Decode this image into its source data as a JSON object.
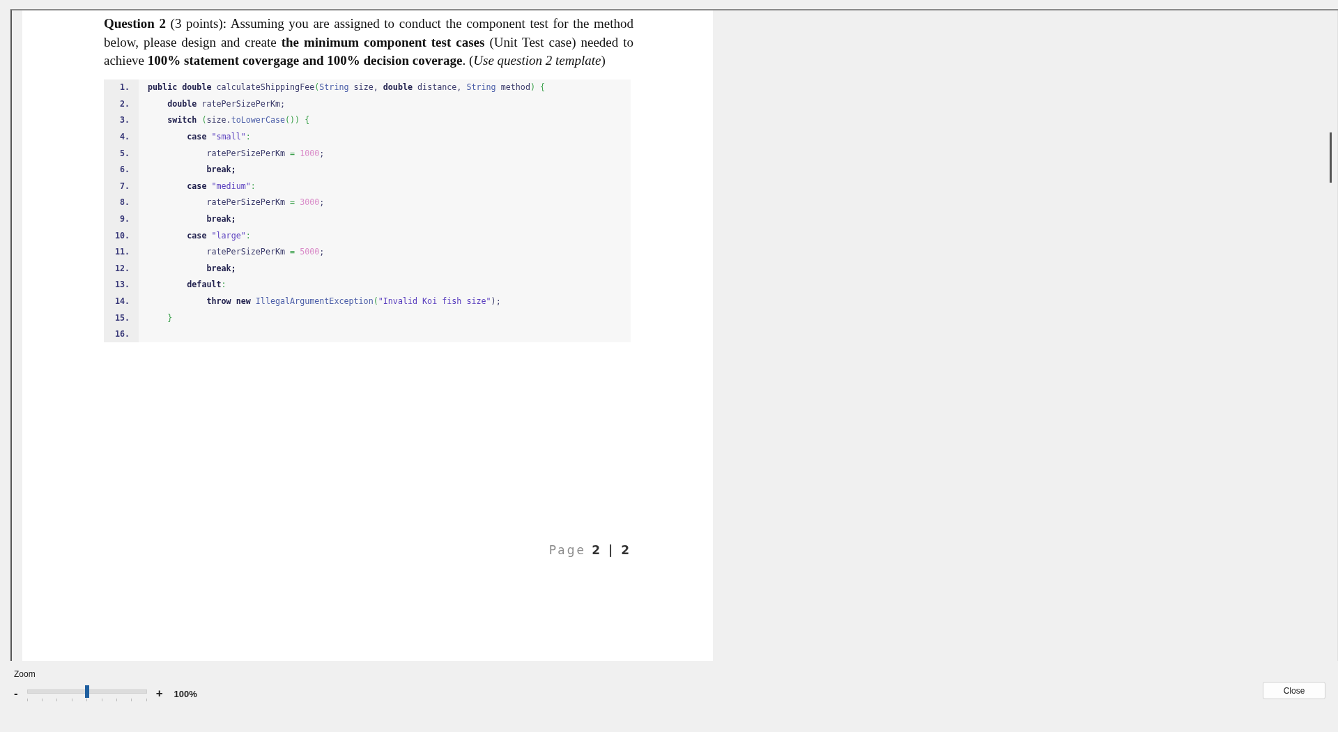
{
  "document": {
    "question": "**Question 2** (3 points): Assuming you are assigned to conduct the component test for the method below, please design and create **the minimum component test cases** (Unit Test case) needed to achieve **100% statement covergage and 100% decision coverage**. (*Use question 2 template*)",
    "code_lines": [
      {
        "number": "1.",
        "tokens": [
          {
            "text": "public double ",
            "kind": "keyword"
          },
          {
            "text": "calculateShippingFee",
            "kind": "name"
          },
          {
            "text": "(",
            "kind": "punct"
          },
          {
            "text": "String ",
            "kind": "type"
          },
          {
            "text": "size, ",
            "kind": "name"
          },
          {
            "text": "double ",
            "kind": "keyword"
          },
          {
            "text": "distance, ",
            "kind": "name"
          },
          {
            "text": "String ",
            "kind": "type"
          },
          {
            "text": "method",
            "kind": "name"
          },
          {
            "text": ") {",
            "kind": "punct"
          }
        ]
      },
      {
        "number": "2.",
        "tokens": [
          {
            "text": "    double ",
            "kind": "keyword"
          },
          {
            "text": "ratePerSizePerKm;",
            "kind": "name"
          }
        ]
      },
      {
        "number": "3.",
        "tokens": [
          {
            "text": "    switch ",
            "kind": "keyword"
          },
          {
            "text": "(",
            "kind": "punct"
          },
          {
            "text": "size.",
            "kind": "name"
          },
          {
            "text": "toLowerCase",
            "kind": "type"
          },
          {
            "text": "()) {",
            "kind": "punct"
          }
        ]
      },
      {
        "number": "4.",
        "tokens": [
          {
            "text": "        case ",
            "kind": "keyword"
          },
          {
            "text": "\"small\"",
            "kind": "string"
          },
          {
            "text": ":",
            "kind": "punct"
          }
        ]
      },
      {
        "number": "5.",
        "tokens": [
          {
            "text": "            ratePerSizePerKm ",
            "kind": "name"
          },
          {
            "text": "= ",
            "kind": "punct"
          },
          {
            "text": "1000",
            "kind": "number"
          },
          {
            "text": ";",
            "kind": "name"
          }
        ]
      },
      {
        "number": "6.",
        "tokens": [
          {
            "text": "            break;",
            "kind": "keyword"
          }
        ]
      },
      {
        "number": "7.",
        "tokens": [
          {
            "text": "        case ",
            "kind": "keyword"
          },
          {
            "text": "\"medium\"",
            "kind": "string"
          },
          {
            "text": ":",
            "kind": "punct"
          }
        ]
      },
      {
        "number": "8.",
        "tokens": [
          {
            "text": "            ratePerSizePerKm ",
            "kind": "name"
          },
          {
            "text": "= ",
            "kind": "punct"
          },
          {
            "text": "3000",
            "kind": "number"
          },
          {
            "text": ";",
            "kind": "name"
          }
        ]
      },
      {
        "number": "9.",
        "tokens": [
          {
            "text": "            break;",
            "kind": "keyword"
          }
        ]
      },
      {
        "number": "10.",
        "tokens": [
          {
            "text": "        case ",
            "kind": "keyword"
          },
          {
            "text": "\"large\"",
            "kind": "string"
          },
          {
            "text": ":",
            "kind": "punct"
          }
        ]
      },
      {
        "number": "11.",
        "tokens": [
          {
            "text": "            ratePerSizePerKm ",
            "kind": "name"
          },
          {
            "text": "= ",
            "kind": "punct"
          },
          {
            "text": "5000",
            "kind": "number"
          },
          {
            "text": ";",
            "kind": "name"
          }
        ]
      },
      {
        "number": "12.",
        "tokens": [
          {
            "text": "            break;",
            "kind": "keyword"
          }
        ]
      },
      {
        "number": "13.",
        "tokens": [
          {
            "text": "        default",
            "kind": "keyword"
          },
          {
            "text": ":",
            "kind": "punct"
          }
        ]
      },
      {
        "number": "14.",
        "tokens": [
          {
            "text": "            throw new ",
            "kind": "keyword"
          },
          {
            "text": "IllegalArgumentException",
            "kind": "type"
          },
          {
            "text": "(",
            "kind": "punct"
          },
          {
            "text": "\"Invalid Koi fish size\"",
            "kind": "string"
          },
          {
            "text": ");",
            "kind": "name"
          }
        ]
      },
      {
        "number": "15.",
        "tokens": [
          {
            "text": "    }",
            "kind": "punct"
          }
        ]
      },
      {
        "number": "16."
      }
    ],
    "page_number": "Page **2 | 2**"
  },
  "zoom": {
    "label": "Zoom",
    "minus": "-",
    "plus": "+",
    "level": 0.5,
    "reading": "100%"
  },
  "close_button": "Close"
}
